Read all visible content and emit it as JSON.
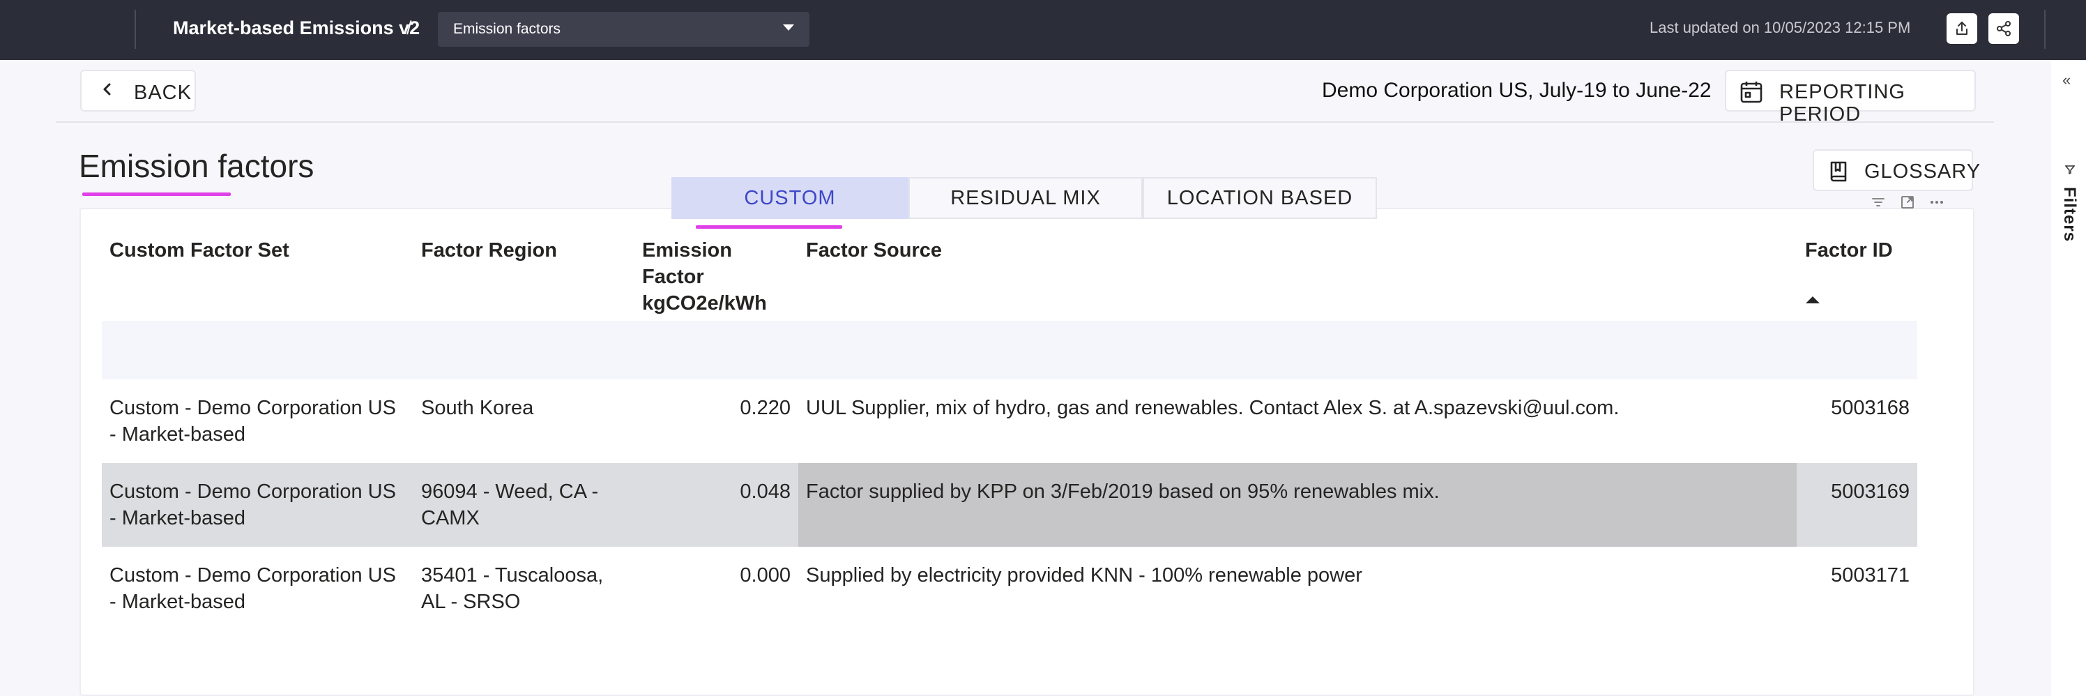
{
  "topbar": {
    "report_title": "Market-based Emissions v2",
    "separator": "/",
    "page_select": {
      "value": "Emission factors",
      "icon": "caret-down-icon"
    },
    "last_updated": "Last updated on 10/05/2023 12:15 PM",
    "export_icon": "export-icon",
    "share_icon": "share-icon"
  },
  "header": {
    "back_label": "BACK",
    "org_period": "Demo Corporation US, July-19 to June-22",
    "reporting_period_label": "REPORTING PERIOD",
    "calendar_icon": "calendar-icon"
  },
  "page": {
    "title": "Emission factors",
    "glossary_label": "GLOSSARY",
    "glossary_icon": "book-icon",
    "accent_color": "#e040e8"
  },
  "tabs": [
    {
      "label": "CUSTOM",
      "active": true
    },
    {
      "label": "RESIDUAL MIX",
      "active": false
    },
    {
      "label": "LOCATION BASED",
      "active": false
    }
  ],
  "visual_icons": [
    "filter-icon",
    "focus-mode-icon",
    "more-options-icon"
  ],
  "rail": {
    "collapse_icon": "double-chevron-left-icon",
    "filters_label": "Filters"
  },
  "table": {
    "columns": [
      "Custom Factor Set",
      "Factor Region",
      "Emission Factor kgCO2e/kWh",
      "Factor Source",
      "Factor ID"
    ],
    "sorted_column": "Factor ID",
    "sort_direction": "ascending",
    "rows": [
      {
        "set": "Custom - Demo Corporation US - Market-based",
        "region": "South Korea",
        "factor": "0.220",
        "source": "UUL Supplier, mix of hydro, gas and renewables. Contact Alex S. at A.spazevski@uul.com.",
        "id": "5003168"
      },
      {
        "set": "Custom - Demo Corporation US - Market-based",
        "region": "96094 - Weed, CA - CAMX",
        "factor": "0.048",
        "source": "Factor supplied by KPP on 3/Feb/2019 based on 95% renewables mix.",
        "id": "5003169"
      },
      {
        "set": "Custom - Demo Corporation US - Market-based",
        "region": "35401 - Tuscaloosa, AL - SRSO",
        "factor": "0.000",
        "source": "Supplied by electricity provided KNN - 100% renewable power",
        "id": "5003171"
      }
    ]
  }
}
